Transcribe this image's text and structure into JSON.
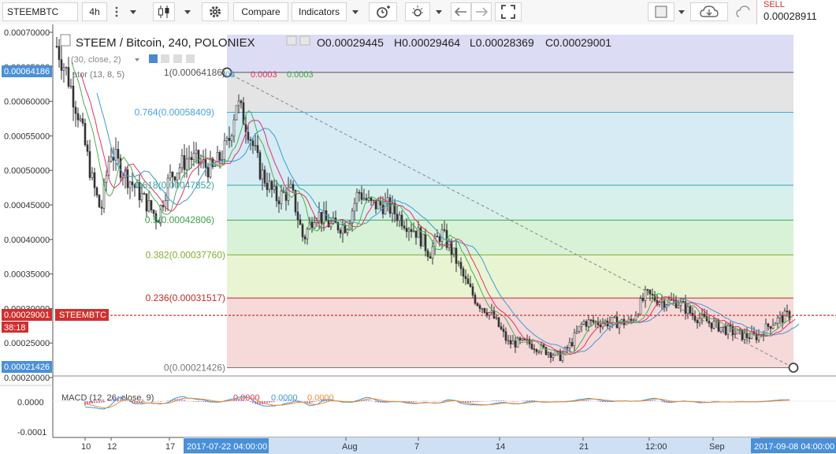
{
  "toolbar": {
    "symbol": "STEEMBTC",
    "interval": "4h",
    "compare_label": "Compare",
    "indicators_label": "Indicators",
    "sell_label": "SELL",
    "sell_price": "0.00028911"
  },
  "legend": {
    "title": "STEEM / Bitcoin, 240, POLONIEX",
    "open": "O0.00029445",
    "high": "H0.00029464",
    "low": "L0.00028369",
    "close": "C0.00029001",
    "ma_label": "(30, close, 2)",
    "alligator_label": "ator (13, 8, 5)",
    "alligator_v1": "03",
    "alligator_v2": "0.0003",
    "alligator_v3": "0.0003"
  },
  "price_axis": {
    "ticks": [
      "0.00070000",
      "0.00065000",
      "0.00060000",
      "0.00055000",
      "0.00050000",
      "0.00045000",
      "0.00040000",
      "0.00035000",
      "0.00030000",
      "0.00025000",
      "0.00020000"
    ],
    "label_top": "0.00064186",
    "label_current": "0.00029001",
    "label_countdown": "38:18",
    "label_bottom": "0.00021426",
    "series_tag": "STEEMBTC"
  },
  "fib_levels": [
    {
      "ratio": "1",
      "label": "1(0.00064186)",
      "value": 0.00064186,
      "color": "#555555"
    },
    {
      "ratio": "0.764",
      "label": "0.764(0.00058409)",
      "value": 0.00058409,
      "color": "#4aa5d8"
    },
    {
      "ratio": "0.618",
      "label": "0.618(0.00047852)",
      "value": 0.00047852,
      "color": "#3aa4a0"
    },
    {
      "ratio": "0.5",
      "label": "0.5(0.00042806)",
      "value": 0.00042806,
      "color": "#3aa54a"
    },
    {
      "ratio": "0.382",
      "label": "0.382(0.00037760)",
      "value": 0.0003776,
      "color": "#7fae2c"
    },
    {
      "ratio": "0.236",
      "label": "0.236(0.00031517)",
      "value": 0.00031517,
      "color": "#c42b2b"
    },
    {
      "ratio": "0",
      "label": "0(0.00021426)",
      "value": 0.00021426,
      "color": "#777777"
    }
  ],
  "macd": {
    "label": "MACD (12, 26, close, 9)",
    "v1": "0.0000",
    "v2": "0.0000",
    "v3": "0.0000",
    "ticks": [
      "0.0000",
      "-0.0001"
    ]
  },
  "time_axis": {
    "labels": [
      "10",
      "12",
      "17",
      "Aug",
      "7",
      "14",
      "21",
      "12:00",
      "Sep"
    ],
    "cursor_left": "2017-07-22 04:00:00",
    "cursor_right": "2017-09-08 04:00:00"
  },
  "colors": {
    "price_up": "#2f2f2f",
    "ma_blue": "#3d9ad6",
    "ma_red": "#e2306c",
    "ma_green": "#4cb04c",
    "current_price": "#d0302e"
  }
}
